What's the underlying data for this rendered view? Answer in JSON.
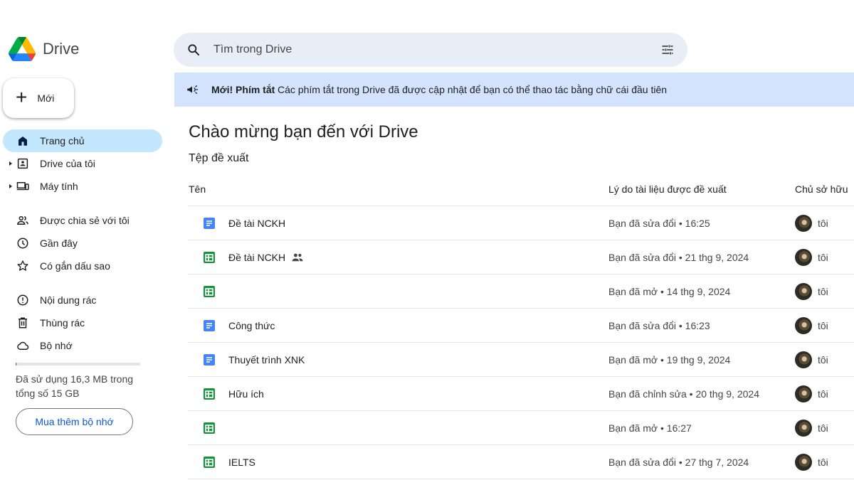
{
  "app": {
    "name": "Drive"
  },
  "sidebar": {
    "new_label": "Mới",
    "items": [
      {
        "label": "Trang chủ",
        "icon": "home-icon",
        "active": true
      },
      {
        "label": "Drive của tôi",
        "icon": "my-drive-icon",
        "caret": true
      },
      {
        "label": "Máy tính",
        "icon": "computer-icon",
        "caret": true
      },
      {
        "label": "Được chia sẻ với tôi",
        "icon": "shared-people-icon"
      },
      {
        "label": "Gần đây",
        "icon": "clock-icon"
      },
      {
        "label": "Có gắn dấu sao",
        "icon": "star-icon"
      },
      {
        "label": "Nội dung rác",
        "icon": "spam-icon"
      },
      {
        "label": "Thùng rác",
        "icon": "trash-icon"
      },
      {
        "label": "Bộ nhớ",
        "icon": "cloud-icon"
      }
    ],
    "storage": {
      "used_fraction": 0.001,
      "text": "Đã sử dụng 16,3 MB trong tổng số 15 GB",
      "buy_label": "Mua thêm bộ nhớ"
    }
  },
  "search": {
    "placeholder": "Tìm trong Drive"
  },
  "banner": {
    "title": "Mới! Phím tắt",
    "text": "Các phím tắt trong Drive đã được cập nhật để bạn có thể thao tác bằng chữ cái đầu tiên"
  },
  "main": {
    "welcome": "Chào mừng bạn đến với Drive",
    "section_title": "Tệp đề xuất",
    "columns": {
      "name": "Tên",
      "reason": "Lý do tài liệu được đề xuất",
      "owner": "Chủ sở hữu"
    },
    "files": [
      {
        "name": "Đề tài NCKH",
        "type": "doc",
        "shared": false,
        "reason": "Bạn đã sửa đổi • 16:25",
        "owner": "tôi"
      },
      {
        "name": "Đề tài NCKH",
        "type": "sheet",
        "shared": true,
        "reason": "Bạn đã sửa đổi • 21 thg 9, 2024",
        "owner": "tôi"
      },
      {
        "name": "",
        "type": "sheet",
        "shared": false,
        "reason": "Bạn đã mở • 14 thg 9, 2024",
        "owner": "tôi"
      },
      {
        "name": "Công thức",
        "type": "doc",
        "shared": false,
        "reason": "Bạn đã sửa đổi • 16:23",
        "owner": "tôi"
      },
      {
        "name": "Thuyết trình XNK",
        "type": "doc",
        "shared": false,
        "reason": "Bạn đã mở • 19 thg 9, 2024",
        "owner": "tôi"
      },
      {
        "name": "Hữu ích",
        "type": "sheet",
        "shared": false,
        "reason": "Bạn đã chỉnh sửa • 20 thg 9, 2024",
        "owner": "tôi"
      },
      {
        "name": "",
        "type": "sheet",
        "shared": false,
        "reason": "Bạn đã mở • 16:27",
        "owner": "tôi"
      },
      {
        "name": "IELTS",
        "type": "sheet",
        "shared": false,
        "reason": "Bạn đã sửa đổi • 27 thg 7, 2024",
        "owner": "tôi"
      }
    ]
  },
  "colors": {
    "accent": "#0b57d0",
    "active_nav": "#c2e7ff",
    "banner_bg": "#d3e3fd",
    "search_bg": "#e9eef6"
  }
}
